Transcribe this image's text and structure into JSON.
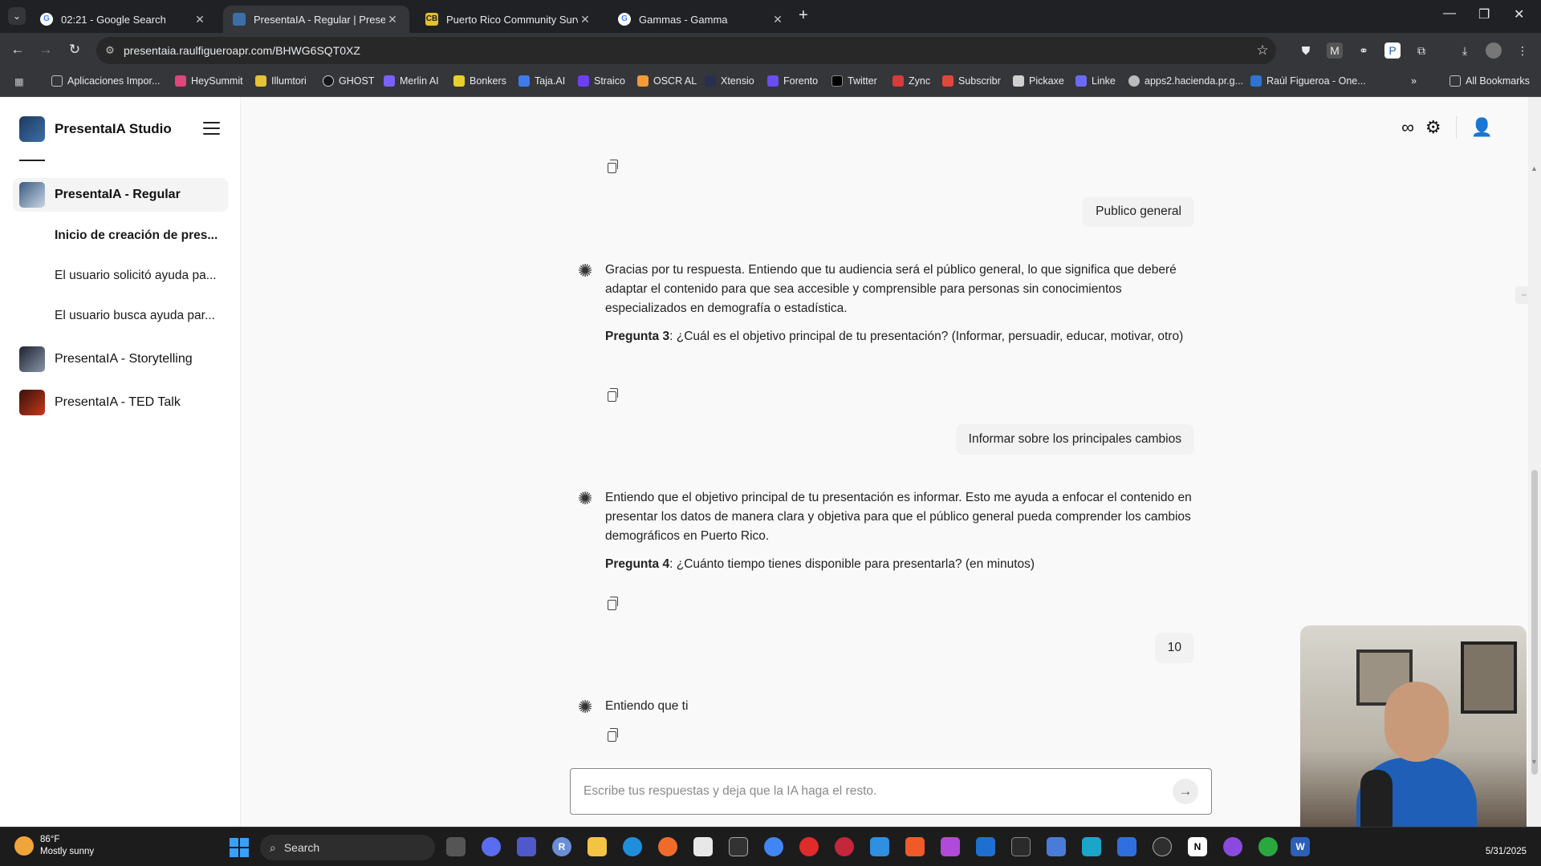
{
  "browser": {
    "tabs": [
      {
        "title": "02:21 - Google Search",
        "icon": "google-icon"
      },
      {
        "title": "PresentaIA - Regular | Presenta",
        "icon": "presentaia-icon",
        "active": true
      },
      {
        "title": "Puerto Rico Community Survey",
        "icon": "cb-icon",
        "icon_text": "CB"
      },
      {
        "title": "Gammas - Gamma",
        "icon": "google-icon"
      }
    ],
    "url": "presentaia.raulfigueroapr.com/BHWG6SQT0XZ",
    "bookmarks": [
      {
        "label": "Aplicaciones Impor...",
        "color": "#8a8a8a"
      },
      {
        "label": "HeySummit",
        "color": "#e0457b"
      },
      {
        "label": "Illumtori",
        "color": "#e6c23a"
      },
      {
        "label": "GHOST",
        "color": "#15171a"
      },
      {
        "label": "Merlin AI",
        "color": "#7b61ff"
      },
      {
        "label": "Bonkers",
        "color": "#e8d02b"
      },
      {
        "label": "Taja.AI",
        "color": "#3f7bea"
      },
      {
        "label": "Straico",
        "color": "#6c3ff5"
      },
      {
        "label": "OSCR AL",
        "color": "#f29b38"
      },
      {
        "label": "Xtensio",
        "color": "#2a2f4f"
      },
      {
        "label": "Forento",
        "color": "#6b4ef0"
      },
      {
        "label": "Twitter",
        "color": "#000000"
      },
      {
        "label": "Zync",
        "color": "#d83b3b"
      },
      {
        "label": "Subscribr",
        "color": "#e0483b"
      },
      {
        "label": "Pickaxe",
        "color": "#d0d0d0"
      },
      {
        "label": "Linke",
        "color": "#6b6bf5"
      },
      {
        "label": "apps2.hacienda.pr.g...",
        "color": "#bbbbbb"
      },
      {
        "label": "Raúl Figueroa - One...",
        "color": "#2f74d0"
      }
    ],
    "all_bookmarks": "All Bookmarks"
  },
  "app": {
    "name": "PresentaIA Studio",
    "sidebar": {
      "items": [
        {
          "label": "PresentaIA - Regular",
          "active": true
        },
        {
          "label": "PresentaIA - Storytelling"
        },
        {
          "label": "PresentaIA - TED Talk"
        }
      ],
      "subitems": [
        {
          "label": "Inicio de creación de pres...",
          "bold": true
        },
        {
          "label": "El usuario solicitó ayuda pa..."
        },
        {
          "label": "El usuario busca ayuda par..."
        }
      ]
    },
    "chat": {
      "user_msg_1": "Publico general",
      "assistant_msg_1": "Gracias por tu respuesta. Entiendo que tu audiencia será el público general, lo que significa que deberé adaptar el contenido para que sea accesible y comprensible para personas sin conocimientos especializados en demografía o estadística.",
      "q3_label": "Pregunta 3",
      "q3_text": ": ¿Cuál es el objetivo principal de tu presentación? (Informar, persuadir, educar, motivar, otro)",
      "user_msg_2": "Informar sobre los principales cambios",
      "assistant_msg_2": "Entiendo que el objetivo principal de tu presentación es informar. Esto me ayuda a enfocar el contenido en presentar los datos de manera clara y objetiva para que el público general pueda comprender los cambios demográficos en Puerto Rico.",
      "q4_label": "Pregunta 4",
      "q4_text": ": ¿Cuánto tiempo tienes disponible para presentarla? (en minutos)",
      "user_msg_3": "10",
      "assistant_msg_3": "Entiendo que ti"
    },
    "input": {
      "placeholder": "Escribe tus respuestas y deja que la IA haga el resto.",
      "value": ""
    }
  },
  "taskbar": {
    "temperature": "86°F",
    "weather": "Mostly sunny",
    "search": "Search",
    "date": "5/31/2025"
  }
}
